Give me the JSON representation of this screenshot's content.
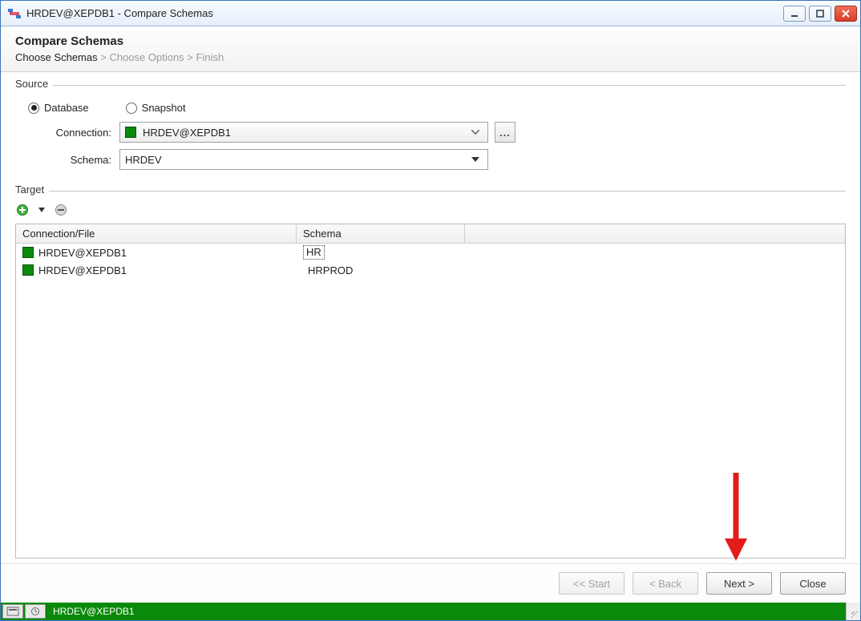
{
  "window": {
    "title": "HRDEV@XEPDB1 - Compare Schemas"
  },
  "header": {
    "title": "Compare Schemas",
    "crumbs": [
      "Choose Schemas",
      "Choose Options",
      "Finish"
    ],
    "sep": " > "
  },
  "source": {
    "group_label": "Source",
    "radio_database": "Database",
    "radio_snapshot": "Snapshot",
    "connection_label": "Connection:",
    "connection_value": "HRDEV@XEPDB1",
    "schema_label": "Schema:",
    "schema_value": "HRDEV",
    "more": "..."
  },
  "target": {
    "group_label": "Target",
    "columns": {
      "col1": "Connection/File",
      "col2": "Schema"
    },
    "rows": [
      {
        "conn": "HRDEV@XEPDB1",
        "schema": "HR",
        "selected": true
      },
      {
        "conn": "HRDEV@XEPDB1",
        "schema": "HRPROD",
        "selected": false
      }
    ]
  },
  "wizard": {
    "start": "<< Start",
    "back": "< Back",
    "next": "Next >",
    "close": "Close"
  },
  "statusbar": {
    "text": "HRDEV@XEPDB1"
  }
}
